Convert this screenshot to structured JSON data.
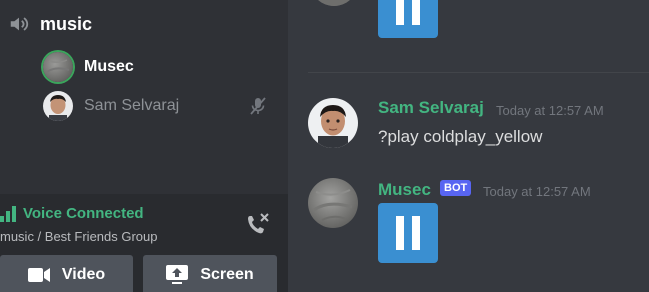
{
  "sidebar": {
    "channel": {
      "name": "music",
      "icon": "speaker-icon"
    },
    "voice_users": [
      {
        "name": "Musec",
        "speaking": true
      },
      {
        "name": "Sam Selvaraj",
        "muted": true
      }
    ],
    "voice_panel": {
      "status": "Voice Connected",
      "location": "music / Best Friends Group",
      "video_label": "Video",
      "screen_label": "Screen"
    }
  },
  "chat": {
    "messages": [
      {
        "author": "Sam Selvaraj",
        "timestamp": "Today at 12:57 AM",
        "text": "?play coldplay_yellow"
      },
      {
        "author": "Musec",
        "tag": "BOT",
        "timestamp": "Today at 12:57 AM",
        "embed": "pause-icon"
      }
    ]
  },
  "colors": {
    "accent_green": "#43b581",
    "bot_tag": "#5865f2",
    "pause_blue": "#3a8fd1",
    "background": "#36393f",
    "sidebar": "#2f3136"
  }
}
